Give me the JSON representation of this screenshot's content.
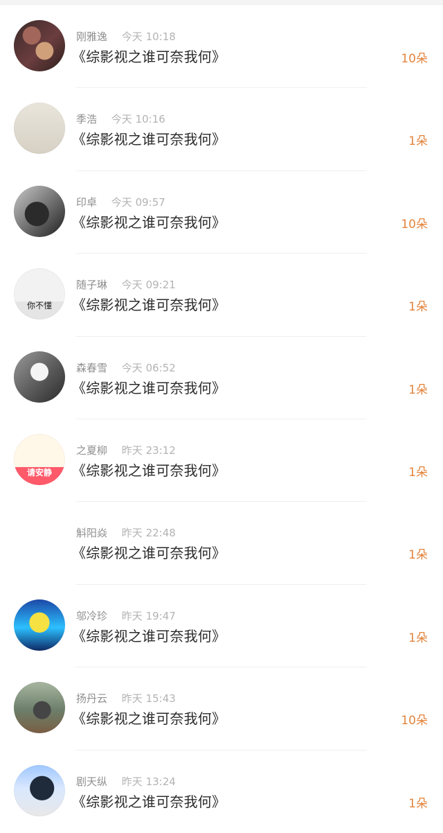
{
  "rows": [
    {
      "name": "刚雅逸",
      "time": "今天 10:18",
      "title": "《综影视之谁可奈我何》",
      "count": "10朵",
      "avatar": {
        "present": true,
        "style": "a1",
        "label": ""
      }
    },
    {
      "name": "季浩",
      "time": "今天 10:16",
      "title": "《综影视之谁可奈我何》",
      "count": "1朵",
      "avatar": {
        "present": true,
        "style": "a2",
        "label": ""
      }
    },
    {
      "name": "印卓",
      "time": "今天 09:57",
      "title": "《综影视之谁可奈我何》",
      "count": "10朵",
      "avatar": {
        "present": true,
        "style": "a3",
        "label": ""
      }
    },
    {
      "name": "随子琳",
      "time": "今天 09:21",
      "title": "《综影视之谁可奈我何》",
      "count": "1朵",
      "avatar": {
        "present": true,
        "style": "a4",
        "label": "你不懂"
      }
    },
    {
      "name": "森春雪",
      "time": "今天 06:52",
      "title": "《综影视之谁可奈我何》",
      "count": "1朵",
      "avatar": {
        "present": true,
        "style": "a5",
        "label": ""
      }
    },
    {
      "name": "之夏柳",
      "time": "昨天 23:12",
      "title": "《综影视之谁可奈我何》",
      "count": "1朵",
      "avatar": {
        "present": true,
        "style": "a6",
        "label": "请安静"
      }
    },
    {
      "name": "斛阳焱",
      "time": "昨天 22:48",
      "title": "《综影视之谁可奈我何》",
      "count": "1朵",
      "avatar": {
        "present": false,
        "style": "",
        "label": ""
      }
    },
    {
      "name": "邬冷珍",
      "time": "昨天 19:47",
      "title": "《综影视之谁可奈我何》",
      "count": "1朵",
      "avatar": {
        "present": true,
        "style": "a8",
        "label": ""
      }
    },
    {
      "name": "扬丹云",
      "time": "昨天 15:43",
      "title": "《综影视之谁可奈我何》",
      "count": "10朵",
      "avatar": {
        "present": true,
        "style": "a9",
        "label": ""
      }
    },
    {
      "name": "剧天纵",
      "time": "昨天 13:24",
      "title": "《综影视之谁可奈我何》",
      "count": "1朵",
      "avatar": {
        "present": true,
        "style": "a10",
        "label": ""
      }
    }
  ]
}
